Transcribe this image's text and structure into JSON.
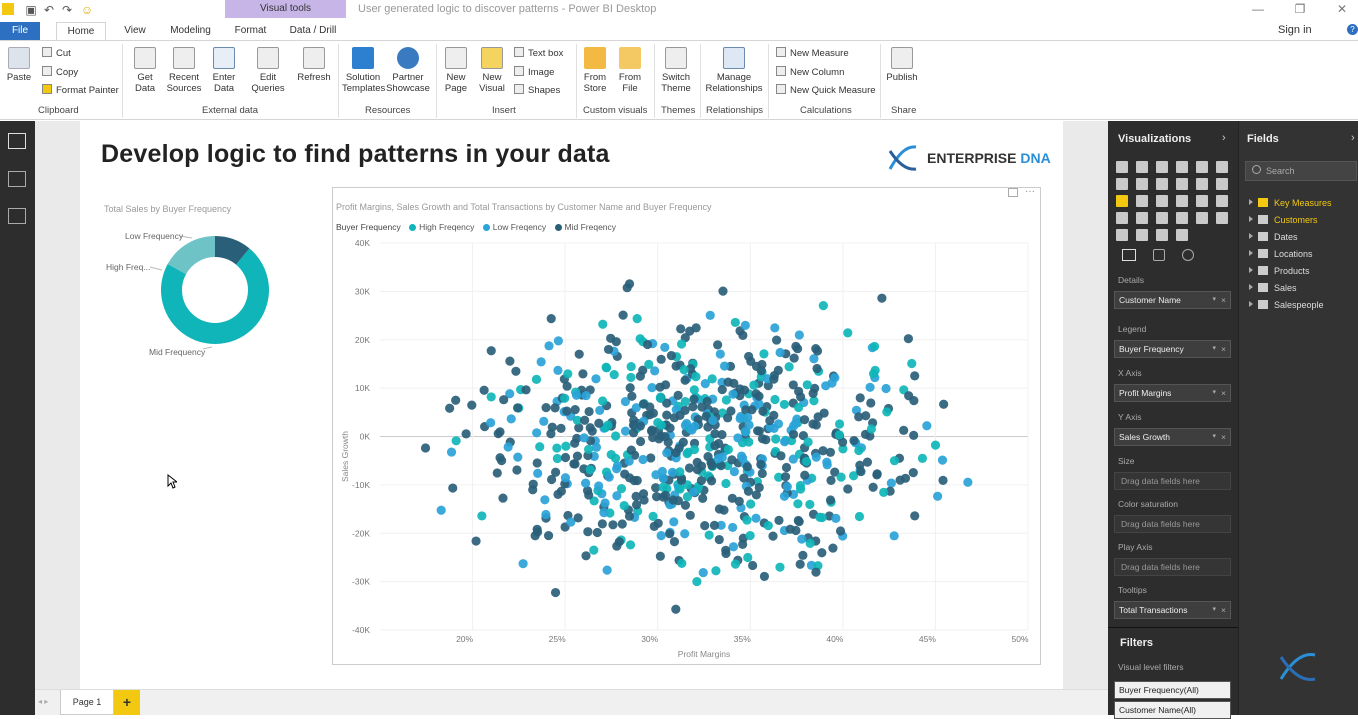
{
  "window": {
    "title": "User generated logic to discover patterns - Power BI Desktop",
    "context_tab": "Visual tools",
    "sign_in": "Sign in"
  },
  "tabs": [
    "File",
    "Home",
    "View",
    "Modeling",
    "Format",
    "Data / Drill"
  ],
  "ribbon": {
    "clipboard": {
      "paste": "Paste",
      "cut": "Cut",
      "copy": "Copy",
      "format_painter": "Format Painter",
      "group": "Clipboard"
    },
    "external": {
      "get_data": "Get\nData",
      "recent": "Recent\nSources",
      "enter": "Enter\nData",
      "edit": "Edit\nQueries",
      "refresh": "Refresh",
      "group": "External data"
    },
    "resources": {
      "solution": "Solution\nTemplates",
      "partner": "Partner\nShowcase",
      "group": "Resources"
    },
    "insert": {
      "new_page": "New\nPage",
      "new_visual": "New\nVisual",
      "text_box": "Text box",
      "image": "Image",
      "shapes": "Shapes",
      "group": "Insert"
    },
    "custom": {
      "store": "From\nStore",
      "file": "From\nFile",
      "group": "Custom visuals"
    },
    "themes": {
      "switch": "Switch\nTheme",
      "group": "Themes"
    },
    "relationships": {
      "manage": "Manage\nRelationships",
      "group": "Relationships"
    },
    "calculations": {
      "measure": "New Measure",
      "column": "New Column",
      "quick": "New Quick Measure",
      "group": "Calculations"
    },
    "share": {
      "publish": "Publish",
      "group": "Share"
    }
  },
  "report": {
    "title": "Develop logic to find patterns in your data",
    "logo_a": "ENTERPRISE",
    "logo_b": "DNA"
  },
  "colors": {
    "high": "#0fb5b8",
    "low": "#2aa3d8",
    "mid": "#2a5f7a",
    "accent_yellow": "#f2c811"
  },
  "donut": {
    "title": "Total Sales by Buyer Frequency",
    "labels": [
      "Low Frequency",
      "High Freq...",
      "Mid Frequency"
    ]
  },
  "chart_data": [
    {
      "type": "pie",
      "title": "Total Sales by Buyer Frequency",
      "categories": [
        "Mid Frequency",
        "High Frequency",
        "Low Frequency"
      ],
      "values": [
        72,
        17,
        11
      ],
      "donut": true
    },
    {
      "type": "scatter",
      "title": "Profit Margins, Sales Growth and Total Transactions by Customer Name and Buyer Frequency",
      "xlabel": "Profit Margins",
      "ylabel": "Sales Growth",
      "xlim": [
        0.15,
        0.5
      ],
      "ylim": [
        -40000,
        40000
      ],
      "xticks": [
        "20%",
        "25%",
        "30%",
        "35%",
        "40%",
        "45%",
        "50%"
      ],
      "yticks": [
        "40K",
        "30K",
        "20K",
        "10K",
        "0K",
        "-10K",
        "-20K",
        "-30K",
        "-40K"
      ],
      "legend_title": "Buyer Frequency",
      "series": [
        {
          "name": "High Freqency"
        },
        {
          "name": "Low Freqency"
        },
        {
          "name": "Mid Freqency"
        }
      ],
      "legend": "top-left"
    }
  ],
  "page_tab": "Page 1",
  "viz": {
    "title": "Visualizations",
    "details": "Details",
    "legend": "Legend",
    "x": "X Axis",
    "y": "Y Axis",
    "size": "Size",
    "sat": "Color saturation",
    "play": "Play Axis",
    "tooltips": "Tooltips",
    "f_customer": "Customer Name",
    "f_freq": "Buyer Frequency",
    "f_profit": "Profit Margins",
    "f_sales": "Sales Growth",
    "f_trans": "Total Transactions",
    "drag": "Drag data fields here",
    "filters": "Filters",
    "vlf": "Visual level filters",
    "flt1": "Buyer Frequency(All)",
    "flt2": "Customer Name(All)"
  },
  "fields": {
    "title": "Fields",
    "search": "Search",
    "items": [
      "Key Measures",
      "Customers",
      "Dates",
      "Locations",
      "Products",
      "Sales",
      "Salespeople"
    ]
  }
}
